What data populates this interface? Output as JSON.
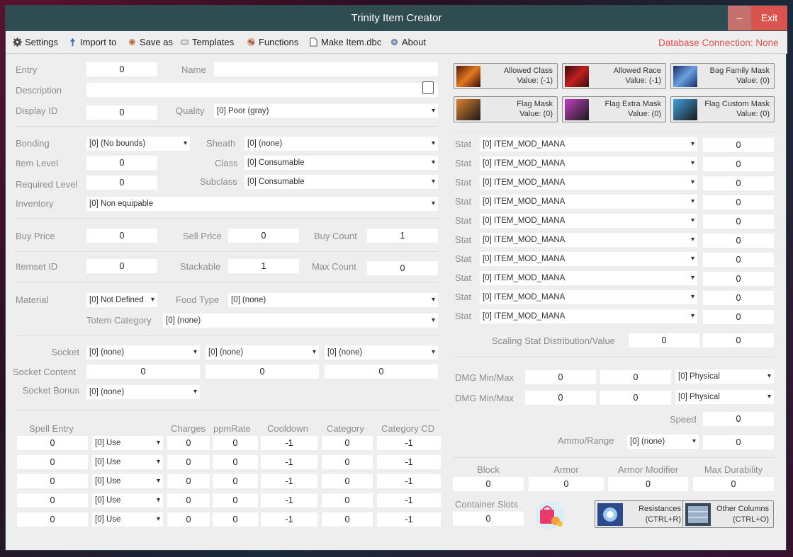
{
  "window": {
    "title": "Trinity Item Creator",
    "min_label": "–",
    "exit_label": "Exit"
  },
  "menu": {
    "settings": "Settings",
    "import": "Import to",
    "save": "Save as",
    "templates": "Templates",
    "functions": "Functions",
    "make": "Make Item.dbc",
    "about": "About",
    "db_status": "Database Connection: None"
  },
  "colors": {
    "titlebar": "#2f4c50",
    "exit": "#d9534f",
    "db_status": "#d9534f",
    "background": "#eeeeee"
  },
  "left": {
    "entry_label": "Entry",
    "entry": "0",
    "name_label": "Name",
    "name": "",
    "description_label": "Description",
    "description": "",
    "display_label": "Display ID",
    "display": "0",
    "quality_label": "Quality",
    "quality": "[0] Poor (gray)",
    "bonding_label": "Bonding",
    "bonding": "[0] (No bounds)",
    "sheath_label": "Sheath",
    "sheath": "[0] (none)",
    "itemlevel_label": "Item Level",
    "itemlevel": "0",
    "class_label": "Class",
    "class": "[0] Consumable",
    "reqlevel_label": "Required Level",
    "reqlevel": "0",
    "subclass_label": "Subclass",
    "subclass": "[0] Consumable",
    "inventory_label": "Inventory",
    "inventory": "[0] Non equipable",
    "buyprice_label": "Buy Price",
    "buyprice": "0",
    "sellprice_label": "Sell Price",
    "sellprice": "0",
    "buycount_label": "Buy Count",
    "buycount": "1",
    "itemset_label": "Itemset ID",
    "itemset": "0",
    "stackable_label": "Stackable",
    "stackable": "1",
    "maxcount_label": "Max Count",
    "maxcount": "0",
    "material_label": "Material",
    "material": "[0]  Not Defined",
    "foodtype_label": "Food Type",
    "foodtype": "[0] (none)",
    "totem_label": "Totem Category",
    "totem": "[0] (none)",
    "socket_label": "Socket",
    "socket1": "[0] (none)",
    "socket2": "[0] (none)",
    "socket3": "[0] (none)",
    "socketcontent_label": "Socket Content",
    "sc1": "0",
    "sc2": "0",
    "sc3": "0",
    "socketbonus_label": "Socket Bonus",
    "socketbonus": "[0] (none)"
  },
  "spells": {
    "headers": [
      "Spell Entry",
      "Charges",
      "ppmRate",
      "Cooldown",
      "Category",
      "Category CD"
    ],
    "rows": [
      {
        "entry": "0",
        "trigger": "[0] Use",
        "charges": "0",
        "ppm": "0",
        "cooldown": "-1",
        "category": "0",
        "catcd": "-1"
      },
      {
        "entry": "0",
        "trigger": "[0] Use",
        "charges": "0",
        "ppm": "0",
        "cooldown": "-1",
        "category": "0",
        "catcd": "-1"
      },
      {
        "entry": "0",
        "trigger": "[0] Use",
        "charges": "0",
        "ppm": "0",
        "cooldown": "-1",
        "category": "0",
        "catcd": "-1"
      },
      {
        "entry": "0",
        "trigger": "[0] Use",
        "charges": "0",
        "ppm": "0",
        "cooldown": "-1",
        "category": "0",
        "catcd": "-1"
      },
      {
        "entry": "0",
        "trigger": "[0] Use",
        "charges": "0",
        "ppm": "0",
        "cooldown": "-1",
        "category": "0",
        "catcd": "-1"
      }
    ]
  },
  "flags": [
    {
      "label": "Allowed Class",
      "value": "Value: (-1)"
    },
    {
      "label": "Allowed Race",
      "value": "Value: (-1)"
    },
    {
      "label": "Bag Family Mask",
      "value": "Value: (0)"
    },
    {
      "label": "Flag Mask",
      "value": "Value: (0)"
    },
    {
      "label": "Flag Extra Mask",
      "value": "Value: (0)"
    },
    {
      "label": "Flag Custom Mask",
      "value": "Value: (0)"
    }
  ],
  "stats": {
    "label": "Stat",
    "rows": [
      {
        "type": "[0]  ITEM_MOD_MANA",
        "value": "0"
      },
      {
        "type": "[0]  ITEM_MOD_MANA",
        "value": "0"
      },
      {
        "type": "[0]  ITEM_MOD_MANA",
        "value": "0"
      },
      {
        "type": "[0]  ITEM_MOD_MANA",
        "value": "0"
      },
      {
        "type": "[0]  ITEM_MOD_MANA",
        "value": "0"
      },
      {
        "type": "[0]  ITEM_MOD_MANA",
        "value": "0"
      },
      {
        "type": "[0]  ITEM_MOD_MANA",
        "value": "0"
      },
      {
        "type": "[0]  ITEM_MOD_MANA",
        "value": "0"
      },
      {
        "type": "[0]  ITEM_MOD_MANA",
        "value": "0"
      },
      {
        "type": "[0]  ITEM_MOD_MANA",
        "value": "0"
      }
    ]
  },
  "scaling": {
    "label": "Scaling Stat Distribution/Value",
    "dist": "0",
    "value": "0"
  },
  "damage": {
    "label": "DMG Min/Max",
    "rows": [
      {
        "min": "0",
        "max": "0",
        "type": "[0] Physical"
      },
      {
        "min": "0",
        "max": "0",
        "type": "[0] Physical"
      }
    ]
  },
  "speed": {
    "label": "Speed",
    "value": "0"
  },
  "ammo": {
    "label": "Ammo/Range",
    "type": "[0] (none)",
    "value": "0"
  },
  "defense": {
    "block_label": "Block",
    "block": "0",
    "armor_label": "Armor",
    "armor": "0",
    "armormod_label": "Armor Modifier",
    "armormod": "0",
    "dur_label": "Max Durability",
    "dur": "0"
  },
  "container": {
    "label": "Container Slots",
    "value": "0"
  },
  "resist": {
    "label": "Resistances",
    "shortcut": "(CTRL+R)"
  },
  "other": {
    "label": "Other Columns",
    "shortcut": "(CTRL+O)"
  }
}
